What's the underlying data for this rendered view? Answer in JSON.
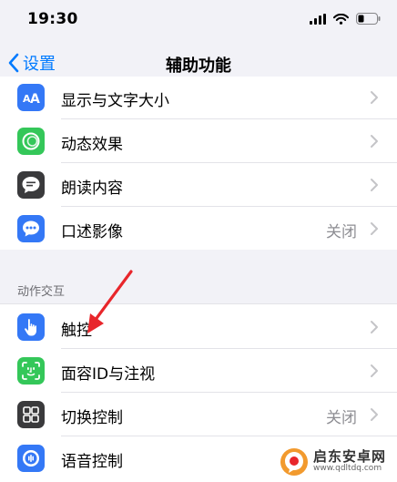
{
  "status_bar": {
    "time": "19:30",
    "icons": [
      "signal-icon",
      "wifi-icon",
      "battery-icon"
    ]
  },
  "nav": {
    "back_label": "设置",
    "title": "辅助功能"
  },
  "vision_items": [
    {
      "label": "显示与文字大小",
      "icon": "text-size-icon",
      "color": "#3478f6",
      "value": ""
    },
    {
      "label": "动态效果",
      "icon": "motion-icon",
      "color": "#34c759",
      "value": ""
    },
    {
      "label": "朗读内容",
      "icon": "speech-bubble-icon",
      "color": "#3a3a3c",
      "value": ""
    },
    {
      "label": "口述影像",
      "icon": "audio-description-icon",
      "color": "#3478f6",
      "value": "关闭"
    }
  ],
  "section_header": "动作交互",
  "interaction_items": [
    {
      "label": "触控",
      "icon": "hand-touch-icon",
      "color": "#3478f6",
      "value": ""
    },
    {
      "label": "面容ID与注视",
      "icon": "face-id-icon",
      "color": "#34c759",
      "value": ""
    },
    {
      "label": "切换控制",
      "icon": "switch-control-icon",
      "color": "#3a3a3c",
      "value": "关闭"
    },
    {
      "label": "语音控制",
      "icon": "voice-control-icon",
      "color": "#3478f6",
      "value": ""
    }
  ],
  "colors": {
    "accent": "#007aff",
    "background": "#f2f2f7",
    "annotation": "#e8262b"
  },
  "watermark": {
    "text": "启东安卓网",
    "url": "www.qdltdq.com"
  }
}
